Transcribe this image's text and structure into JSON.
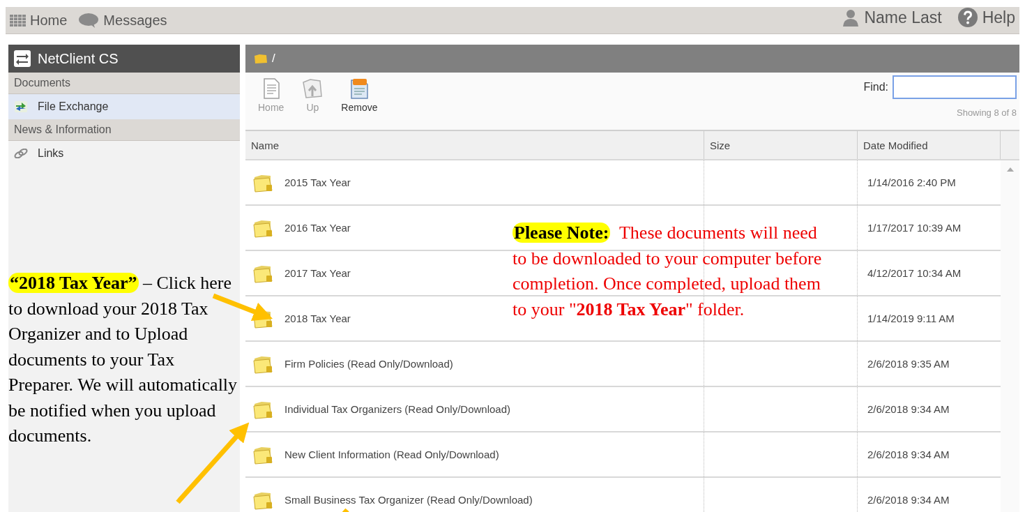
{
  "top_bar": {
    "left": [
      {
        "kind": "grid",
        "label": "Home"
      },
      {
        "kind": "bubble",
        "label": "Messages"
      }
    ],
    "right": [
      {
        "kind": "user",
        "label": "Name Last"
      },
      {
        "kind": "help",
        "label": "Help"
      }
    ]
  },
  "sidebar": {
    "title": "NetClient CS",
    "items": [
      {
        "kind": "section",
        "label": "Documents"
      },
      {
        "kind": "exchange",
        "label": "File Exchange",
        "selected": true
      },
      {
        "kind": "section",
        "label": "News & Information"
      },
      {
        "kind": "link",
        "label": "Links",
        "selected": false
      }
    ]
  },
  "content": {
    "path": "/",
    "toolbar": [
      {
        "kind": "home",
        "label": "Home",
        "disabled": true
      },
      {
        "kind": "up",
        "label": "Up",
        "disabled": true
      },
      {
        "kind": "remove",
        "label": "Remove",
        "disabled": false
      }
    ],
    "find": {
      "label": "Find:"
    },
    "showing": "Showing 8 of 8",
    "table": {
      "columns": [
        "Name",
        "Size",
        "Date Modified"
      ],
      "rows": [
        {
          "name": "2015 Tax Year",
          "size": "",
          "date": "1/14/2016 2:40 PM"
        },
        {
          "name": "2016 Tax Year",
          "size": "",
          "date": "1/17/2017 10:39 AM"
        },
        {
          "name": "2017 Tax Year",
          "size": "",
          "date": "4/12/2017 10:34 AM"
        },
        {
          "name": "2018 Tax Year",
          "size": "",
          "date": "1/14/2019 9:11 AM"
        },
        {
          "name": "Firm Policies (Read Only/Download)",
          "size": "",
          "date": "2/6/2018 9:35 AM"
        },
        {
          "name": "Individual Tax Organizers (Read Only/Download)",
          "size": "",
          "date": "2/6/2018 9:34 AM"
        },
        {
          "name": "New Client Information (Read Only/Download)",
          "size": "",
          "date": "2/6/2018 9:34 AM"
        },
        {
          "name": "Small Business Tax Organizer (Read Only/Download)",
          "size": "",
          "date": "2/6/2018 9:34 AM"
        }
      ]
    }
  },
  "annotations": {
    "left_note": {
      "highlight": "“2018 Tax Year”",
      "text": " – Click here to download your 2018 Tax Organizer and to Upload documents to your Tax Preparer. We will automatically be notified when you upload documents."
    },
    "right_note": {
      "highlight": "Please Note:",
      "text": "  These documents will need to be downloaded to your computer before completion. Once completed, upload them to your \"**2018 Tax Year**\" folder."
    }
  }
}
